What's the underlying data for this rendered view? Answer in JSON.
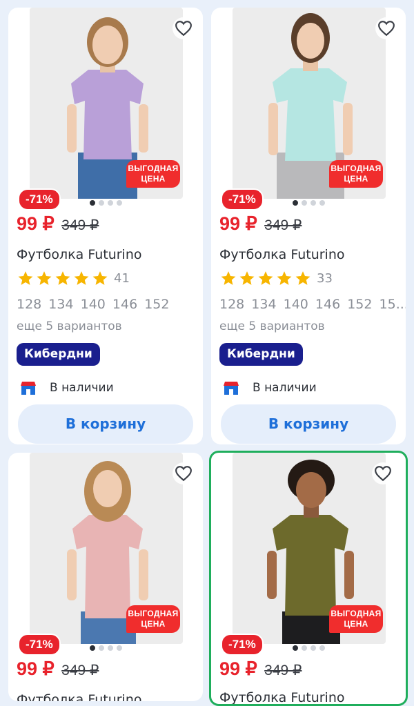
{
  "products": [
    {
      "badge": "ВЫГОДНАЯ ЦЕНА",
      "badge_line1": "ВЫГОДНАЯ",
      "badge_line2": "ЦЕНА",
      "discount": "-71%",
      "price": "99 ₽",
      "old_price": "349 ₽",
      "title": "Футболка Futurino",
      "rating_count": "41",
      "sizes": "128 134 140 146 152",
      "more_variants": "еще 5 вариантов",
      "promo": "Кибердни",
      "availability": "В наличии",
      "cart_label": "В корзину",
      "shirt_color": "#b9a0d8"
    },
    {
      "badge": "ВЫГОДНАЯ ЦЕНА",
      "badge_line1": "ВЫГОДНАЯ",
      "badge_line2": "ЦЕНА",
      "discount": "-71%",
      "price": "99 ₽",
      "old_price": "349 ₽",
      "title": "Футболка Futurino",
      "rating_count": "33",
      "sizes": "128 134 140 146 152 15...",
      "more_variants": "еще 5 вариантов",
      "promo": "Кибердни",
      "availability": "В наличии",
      "cart_label": "В корзину",
      "shirt_color": "#b5e6e2"
    },
    {
      "badge": "ВЫГОДНАЯ ЦЕНА",
      "badge_line1": "ВЫГОДНАЯ",
      "badge_line2": "ЦЕНА",
      "discount": "-71%",
      "price": "99 ₽",
      "old_price": "349 ₽",
      "title": "Футболка Futurino",
      "shirt_color": "#e8b4b4"
    },
    {
      "badge": "ВЫГОДНАЯ ЦЕНА",
      "badge_line1": "ВЫГОДНАЯ",
      "badge_line2": "ЦЕНА",
      "discount": "-71%",
      "price": "99 ₽",
      "old_price": "349 ₽",
      "title": "Футболка Futurino",
      "shirt_color": "#6d6a2c"
    }
  ],
  "colors": {
    "background": "#e9f0fa",
    "price_red": "#e8232c",
    "promo_navy": "#1a1f8e",
    "cart_blue": "#1e6fd9",
    "selected_border": "#1fae5c",
    "star": "#f7b500"
  },
  "icons": {
    "favorite": "heart-outline-icon",
    "store": "store-icon",
    "rating": "star-icon"
  }
}
